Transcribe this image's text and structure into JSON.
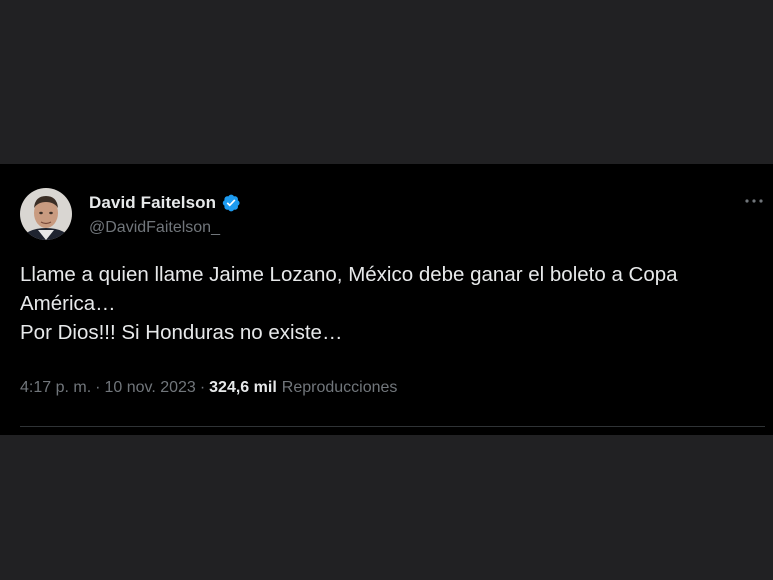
{
  "author": {
    "display_name": "David Faitelson",
    "handle": "@DavidFaitelson_",
    "verified_icon": "verified-badge-icon",
    "verified_color": "#1d9bf0"
  },
  "tweet": {
    "lines": [
      "Llame a quien llame Jaime Lozano, México debe ganar el boleto a Copa",
      "América…",
      "Por Dios!!! Si Honduras no existe…"
    ]
  },
  "meta": {
    "time": "4:17 p. m.",
    "separator": "·",
    "date": "10 nov. 2023",
    "views_count": "324,6 mil",
    "views_label": "Reproducciones"
  },
  "colors": {
    "background": "#212123",
    "card": "#000000",
    "text_primary": "#e7e9ea",
    "text_secondary": "#71767b"
  }
}
